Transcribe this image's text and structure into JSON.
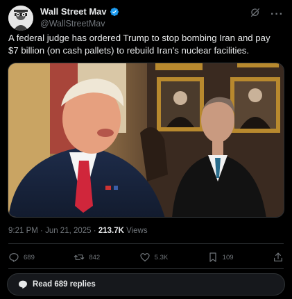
{
  "author": {
    "display_name": "Wall Street Mav",
    "handle": "@WallStreetMav",
    "verified": true,
    "verified_color": "#1d9bf0"
  },
  "tweet": {
    "text": "A federal judge has ordered Trump to stop bombing Iran and pay $7 billion (on cash pallets) to rebuild Iran's nuclear facilities."
  },
  "meta": {
    "time": "9:21 PM",
    "date": "Jun 21, 2025",
    "views_count": "213.7K",
    "views_label": "Views"
  },
  "actions": {
    "replies": "689",
    "retweets": "842",
    "likes": "5.3K",
    "bookmarks": "109"
  },
  "read_replies": {
    "label": "Read 689 replies"
  },
  "icons": {
    "grok": "grok-icon",
    "more": "more-icon",
    "reply": "reply-icon",
    "retweet": "retweet-icon",
    "like": "heart-icon",
    "bookmark": "bookmark-icon",
    "share": "share-icon",
    "chat": "chat-bubble-icon"
  },
  "colors": {
    "background": "#000000",
    "text": "#e7e9ea",
    "muted": "#71767b",
    "border": "#2f3336"
  }
}
